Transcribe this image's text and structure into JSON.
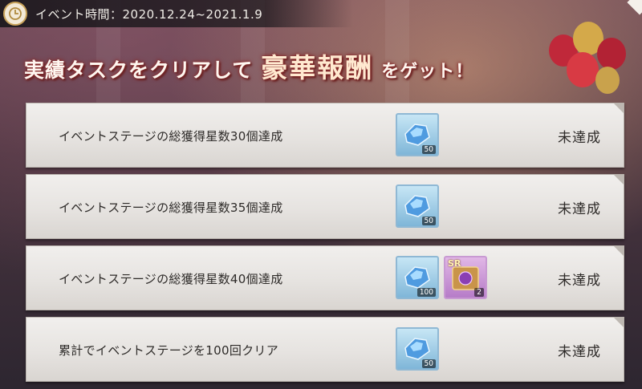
{
  "event": {
    "label": "イベント時間：2020.12.24~2021.1.9",
    "icon": "clock-icon"
  },
  "banner": {
    "part1": "実績タスクをクリアして",
    "part2": "豪華報酬",
    "part3": "をゲット！"
  },
  "tasks": [
    {
      "label": "イベントステージの総獲得星数30個達成",
      "status": "未達成",
      "rewards": [
        {
          "icon": "gem-icon",
          "qty": "50"
        }
      ]
    },
    {
      "label": "イベントステージの総獲得星数35個達成",
      "status": "未達成",
      "rewards": [
        {
          "icon": "gem-icon",
          "qty": "50"
        }
      ]
    },
    {
      "label": "イベントステージの総獲得星数40個達成",
      "status": "未達成",
      "rewards": [
        {
          "icon": "gem-icon",
          "qty": "100"
        },
        {
          "icon": "sr-ticket-icon",
          "qty": "2",
          "text": "SR"
        }
      ]
    },
    {
      "label": "累計でイベントステージを100回クリア",
      "status": "未達成",
      "rewards": [
        {
          "icon": "gem-icon",
          "qty": "50"
        }
      ]
    }
  ],
  "colors": {
    "row_bg": "#e6e3e0",
    "text": "#2e2b29",
    "gem_frame": "#8fb8d4",
    "banner_glow": "#8a2b2b"
  }
}
